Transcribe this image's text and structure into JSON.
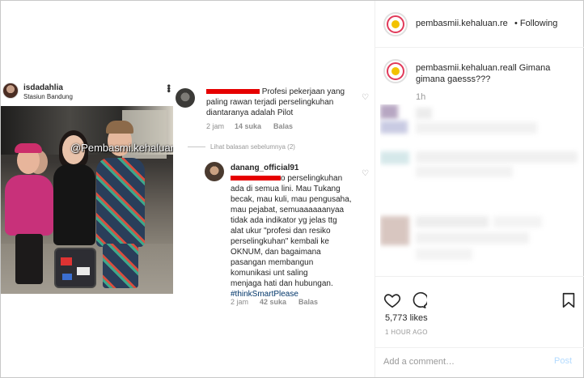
{
  "embedded_post": {
    "username": "isdadahlia",
    "location": "Stasiun Bandung",
    "watermark": "@Pembasmi.kehaluan.real"
  },
  "comments": [
    {
      "text_lines": [
        "Profesi pekerjaan yang",
        "paling rawan terjadi perselingkuhan",
        "diantaranya adalah Pilot"
      ],
      "time": "2 jam",
      "likes": "14 suka",
      "reply": "Balas"
    },
    {
      "view_replies": "Lihat balasan sebelumnya (2)",
      "username": "danang_official91",
      "text_first_suffix": "o perselingkuhan",
      "text_lines": [
        "ada di semua lini. Mau Tukang",
        "becak, mau kuli, mau pengusaha,",
        "mau pejabat, semuaaaaaanyaa",
        "tidak ada indikator yg jelas ttg",
        "alat ukur \"profesi dan resiko",
        "perselingkuhan\" kembali ke",
        "OKNUM, dan bagaimana",
        "pasangan membangun",
        "komunikasi unt saling",
        "menjaga hati dan hubungan."
      ],
      "hashtag": "#thinkSmartPlease",
      "time": "2 jam",
      "likes": "42 suka",
      "reply": "Balas"
    }
  ],
  "sidebar": {
    "username": "pembasmii.kehaluan.re",
    "separator": "•",
    "follow_state": "Following",
    "caption_user": "pembasmii.kehaluan.reall",
    "caption_text": "Gimana gimana gaesss???",
    "caption_time": "1h",
    "likes": "5,773 likes",
    "posted_ago": "1 HOUR AGO",
    "comment_placeholder": "Add a comment…",
    "post_label": "Post"
  },
  "icons": {
    "like": "heart-icon",
    "comment": "comment-bubble-icon",
    "save": "bookmark-icon",
    "more": "more-dots-icon"
  },
  "colors": {
    "redaction": "#e60000",
    "link_blue": "#003569",
    "muted": "#8e8e8e",
    "post_disabled": "#b3dbff"
  }
}
